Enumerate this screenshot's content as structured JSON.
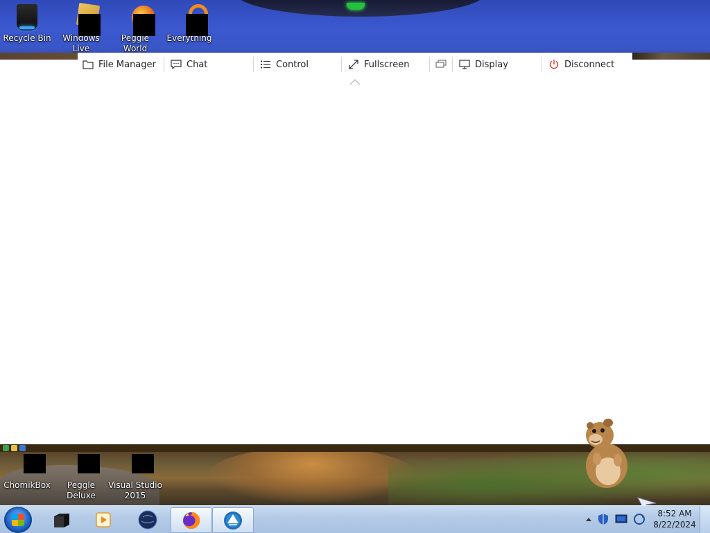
{
  "desktop_top_icons": [
    {
      "label": "Recycle Bin",
      "icon": "recycle-bin-icon"
    },
    {
      "label": "Windows Live",
      "icon": "windows-live-icon"
    },
    {
      "label": "Peggle World",
      "icon": "peggle-world-icon"
    },
    {
      "label": "Everything",
      "icon": "everything-icon"
    }
  ],
  "toolbar": {
    "file_manager": "File Manager",
    "chat": "Chat",
    "control": "Control",
    "fullscreen": "Fullscreen",
    "display": "Display",
    "disconnect": "Disconnect"
  },
  "desktop_bottom_icons": [
    {
      "label": "ChomikBox",
      "icon": "chomikbox-icon"
    },
    {
      "label": "Peggle Deluxe",
      "icon": "peggle-deluxe-icon"
    },
    {
      "label": "Visual Studio 2015",
      "icon": "visual-studio-icon"
    }
  ],
  "taskbar": {
    "pinned": [
      {
        "name": "windows-explorer-icon"
      },
      {
        "name": "media-player-icon"
      },
      {
        "name": "globe-icon"
      },
      {
        "name": "firefox-icon",
        "active": true
      },
      {
        "name": "remote-app-icon",
        "active": true
      }
    ],
    "clock": {
      "time": "8:52 AM",
      "date": "8/22/2024"
    }
  },
  "colors": {
    "desktop_blue": "#3b58cf",
    "taskbar": "#b4cbe7",
    "toolbar_text": "#222222",
    "disconnect_icon": "#d9342b"
  }
}
